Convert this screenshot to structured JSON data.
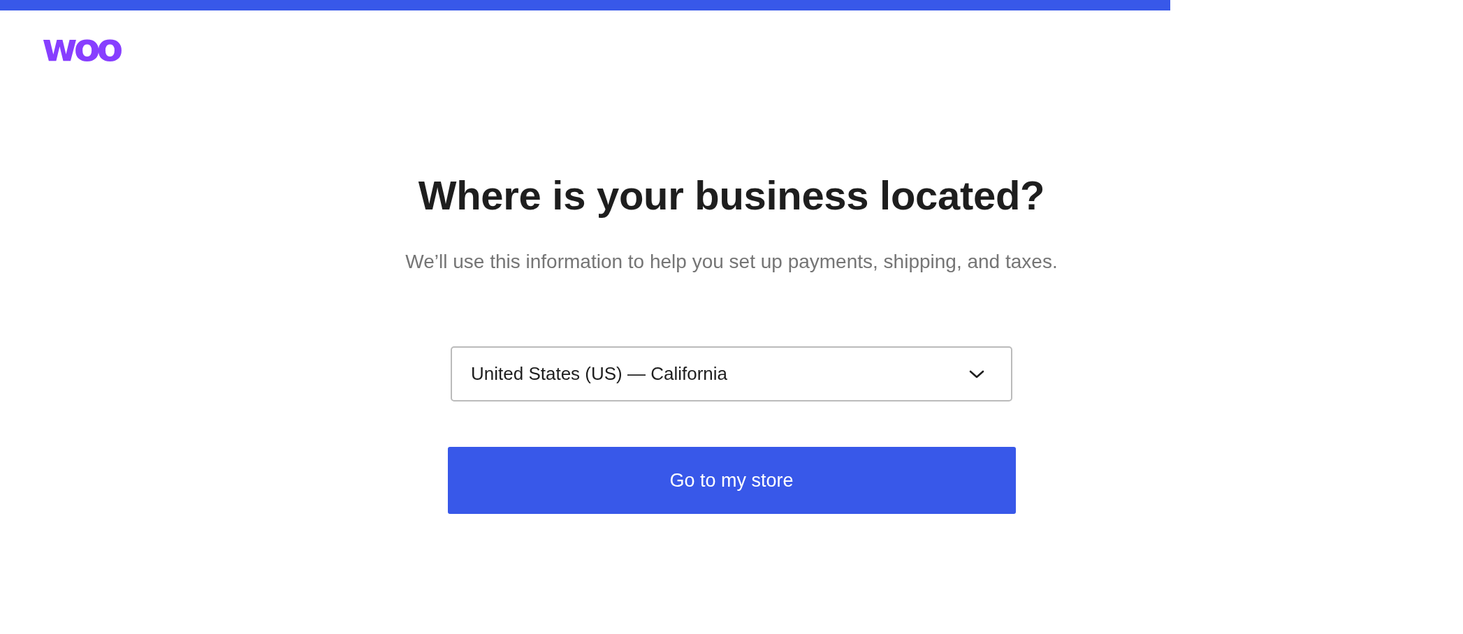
{
  "progress": {
    "level": 0.8
  },
  "logo": {
    "text": "woo"
  },
  "heading": "Where is your business located?",
  "subtitle": "We’ll use this information to help you set up payments, shipping, and taxes.",
  "location_select": {
    "value": "United States (US) — California"
  },
  "primary_button": {
    "label": "Go to my store"
  }
}
